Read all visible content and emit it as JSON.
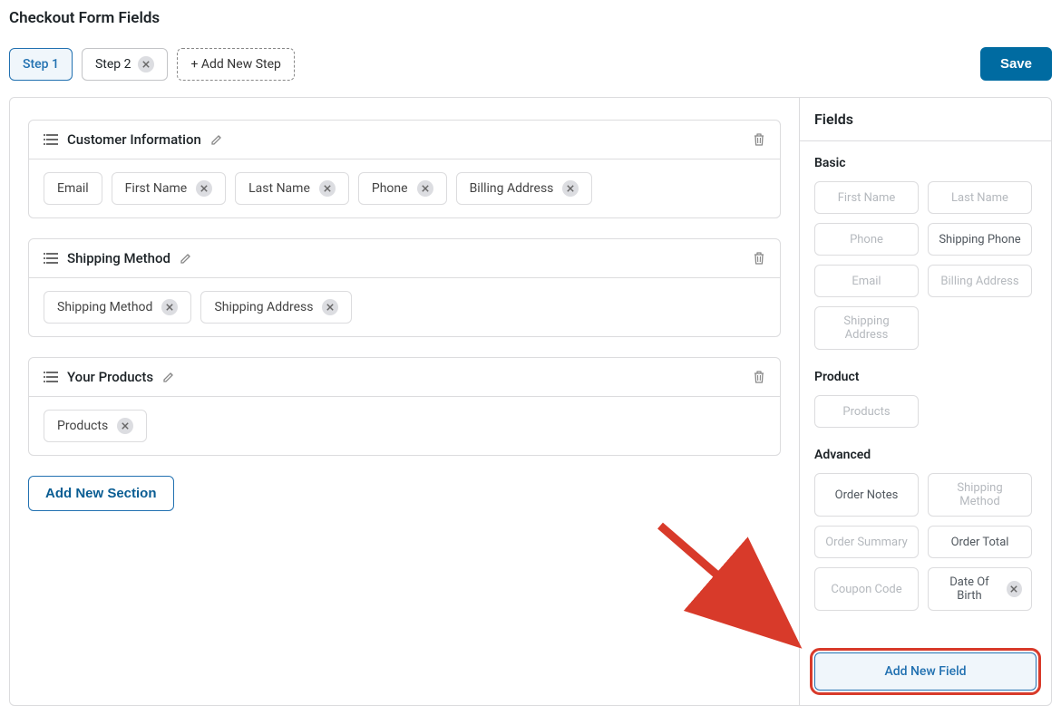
{
  "page_title": "Checkout Form Fields",
  "save_label": "Save",
  "steps": {
    "active": "Step 1",
    "second": "Step 2",
    "add": "+ Add New Step"
  },
  "sections": [
    {
      "title": "Customer Information",
      "chips": [
        {
          "label": "Email",
          "removable": false
        },
        {
          "label": "First Name",
          "removable": true
        },
        {
          "label": "Last Name",
          "removable": true
        },
        {
          "label": "Phone",
          "removable": true
        },
        {
          "label": "Billing Address",
          "removable": true
        }
      ]
    },
    {
      "title": "Shipping Method",
      "chips": [
        {
          "label": "Shipping Method",
          "removable": true
        },
        {
          "label": "Shipping Address",
          "removable": true
        }
      ]
    },
    {
      "title": "Your Products",
      "chips": [
        {
          "label": "Products",
          "removable": true
        }
      ]
    }
  ],
  "add_section_label": "Add New Section",
  "right": {
    "header": "Fields",
    "groups": [
      {
        "title": "Basic",
        "pills": [
          {
            "label": "First Name",
            "state": "disabled"
          },
          {
            "label": "Last Name",
            "state": "disabled"
          },
          {
            "label": "Phone",
            "state": "disabled"
          },
          {
            "label": "Shipping Phone",
            "state": "normal"
          },
          {
            "label": "Email",
            "state": "disabled"
          },
          {
            "label": "Billing Address",
            "state": "disabled"
          },
          {
            "label": "Shipping Address",
            "state": "disabled"
          }
        ]
      },
      {
        "title": "Product",
        "pills": [
          {
            "label": "Products",
            "state": "disabled"
          }
        ]
      },
      {
        "title": "Advanced",
        "pills": [
          {
            "label": "Order Notes",
            "state": "normal"
          },
          {
            "label": "Shipping Method",
            "state": "disabled"
          },
          {
            "label": "Order Summary",
            "state": "disabled"
          },
          {
            "label": "Order Total",
            "state": "normal"
          },
          {
            "label": "Coupon Code",
            "state": "disabled"
          },
          {
            "label": "Date Of Birth",
            "state": "normal",
            "removable": true
          }
        ]
      }
    ],
    "add_field_label": "Add New Field"
  }
}
